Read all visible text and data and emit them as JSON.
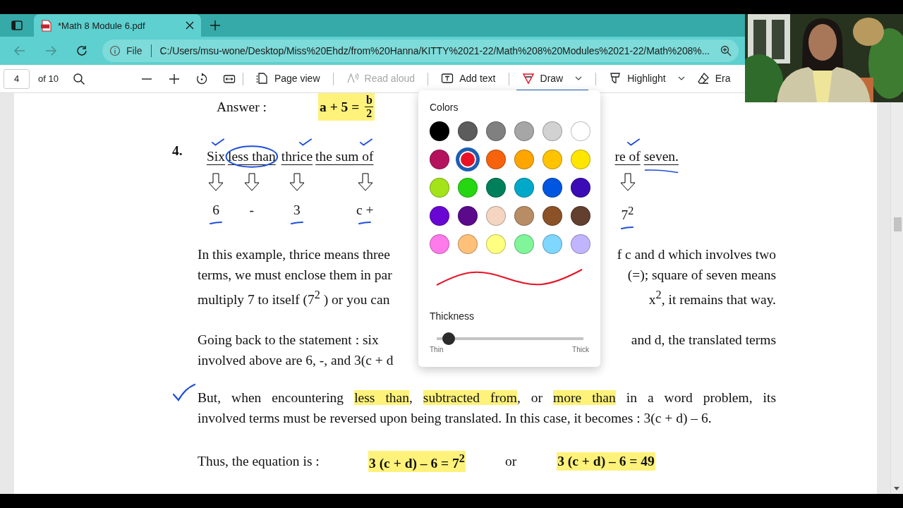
{
  "tab": {
    "title": "*Math 8 Module 6.pdf"
  },
  "address": {
    "scheme": "File",
    "url": "C:/Users/msu-wone/Desktop/Miss%20Ehdz/from%20Hanna/KITTY%2021-22/Math%208%20Modules%2021-22/Math%208%..."
  },
  "toolbar": {
    "page": "4",
    "page_count": "of 10",
    "items": [
      {
        "kind": "page-view",
        "label": "Page view",
        "disabled": false,
        "selected": false,
        "dropdown": false
      },
      {
        "kind": "read-aloud",
        "label": "Read aloud",
        "disabled": true,
        "selected": false,
        "dropdown": false
      },
      {
        "kind": "add-text",
        "label": "Add text",
        "disabled": false,
        "selected": false,
        "dropdown": false
      },
      {
        "kind": "draw",
        "label": "Draw",
        "disabled": false,
        "selected": true,
        "dropdown": true
      },
      {
        "kind": "highlight",
        "label": "Highlight",
        "disabled": false,
        "selected": false,
        "dropdown": true
      },
      {
        "kind": "erase",
        "label": "Era",
        "disabled": false,
        "selected": false,
        "dropdown": false
      }
    ]
  },
  "document": {
    "answer": {
      "label": "Answer :",
      "lhs": "a + 5 =",
      "numerator": "b",
      "denominator": "2"
    },
    "problem": {
      "number": "4.",
      "columns": [
        {
          "words": [
            {
              "text": "Six",
              "checked": true,
              "circled": false,
              "ink_underlined": false
            }
          ],
          "term": "6",
          "term_ink": true
        },
        {
          "words": [
            {
              "text": "less than",
              "checked": false,
              "circled": true,
              "ink_underlined": false
            }
          ],
          "term": "-",
          "term_ink": false
        },
        {
          "words": [
            {
              "text": "thrice",
              "checked": true,
              "circled": false,
              "ink_underlined": false
            }
          ],
          "term": "3",
          "term_ink": true
        },
        {
          "words": [
            {
              "text": "the sum of",
              "checked": true,
              "circled": false,
              "ink_underlined": false
            }
          ],
          "term": "c +",
          "term_ink": true
        },
        {
          "words": [
            {
              "text": "re of",
              "checked": true,
              "circled": false,
              "ink_underlined": false
            },
            {
              "text": "seven.",
              "checked": false,
              "circled": false,
              "ink_underlined": true
            }
          ],
          "term": "7$^{2}$",
          "term_ink": true
        }
      ]
    },
    "paragraph_1": [
      {
        "left": "In this example, thrice means three",
        "right": "f c and d which involves two"
      },
      {
        "left": "terms, we must enclose them in par",
        "right": "(=); square of seven means"
      },
      {
        "left": "multiply 7 to itself (7$^{2}$ ) or you can",
        "right": "x$^{2}$, it remains that way."
      }
    ],
    "paragraph_2": [
      {
        "left": "Going back to the statement : six",
        "right": "and d, the translated terms"
      },
      {
        "left": "involved above are 6, -, and 3(c + d"
      }
    ],
    "paragraph_3": {
      "checked": true,
      "lines": [
        [
          {
            "text": "But, when encountering ",
            "highlight": false
          },
          {
            "text": "less than",
            "highlight": true
          },
          {
            "text": ", ",
            "highlight": false
          },
          {
            "text": "subtracted from",
            "highlight": true
          },
          {
            "text": ", or ",
            "highlight": false
          },
          {
            "text": "more than",
            "highlight": true
          },
          {
            "text": " in a word problem, its",
            "highlight": false
          }
        ],
        [
          {
            "text": "involved terms must be reversed upon being translated. In this case, it becomes : 3(c + d) – 6.",
            "highlight": false
          }
        ]
      ]
    },
    "conclusion": {
      "label": "Thus, the equation is :",
      "equation_1": "3 (c + d) – 6 =  7$^{2}$",
      "connector": "or",
      "equation_2": "3 (c + d) – 6 =  49"
    }
  },
  "draw_menu": {
    "colors_label": "Colors",
    "swatches": [
      {
        "color": "#000000",
        "selected": false
      },
      {
        "color": "#5c5c5c",
        "selected": false
      },
      {
        "color": "#808080",
        "selected": false
      },
      {
        "color": "#a6a6a6",
        "selected": false
      },
      {
        "color": "#d2d2d2",
        "selected": false
      },
      {
        "color": "#ffffff",
        "selected": false
      },
      {
        "color": "#b5125e",
        "selected": false
      },
      {
        "color": "#e81224",
        "selected": true
      },
      {
        "color": "#f7630c",
        "selected": false
      },
      {
        "color": "#ffa500",
        "selected": false
      },
      {
        "color": "#ffc300",
        "selected": false
      },
      {
        "color": "#ffe600",
        "selected": false
      },
      {
        "color": "#a4e31a",
        "selected": false
      },
      {
        "color": "#26d611",
        "selected": false
      },
      {
        "color": "#00805a",
        "selected": false
      },
      {
        "color": "#00a9c9",
        "selected": false
      },
      {
        "color": "#0056e0",
        "selected": false
      },
      {
        "color": "#3b0cb6",
        "selected": false
      },
      {
        "color": "#6a06d3",
        "selected": false
      },
      {
        "color": "#5c0a8c",
        "selected": false
      },
      {
        "color": "#f4d5c2",
        "selected": false
      },
      {
        "color": "#b88d66",
        "selected": false
      },
      {
        "color": "#8b5228",
        "selected": false
      },
      {
        "color": "#623f2f",
        "selected": false
      },
      {
        "color": "#ff7aeb",
        "selected": false
      },
      {
        "color": "#ffc07a",
        "selected": false
      },
      {
        "color": "#ffff80",
        "selected": false
      },
      {
        "color": "#80f59a",
        "selected": false
      },
      {
        "color": "#7fd6ff",
        "selected": false
      },
      {
        "color": "#c2b5ff",
        "selected": false
      }
    ],
    "thickness_label": "Thickness",
    "thickness": {
      "level": 0.04,
      "min_label": "Thin",
      "max_label": "Thick"
    }
  }
}
